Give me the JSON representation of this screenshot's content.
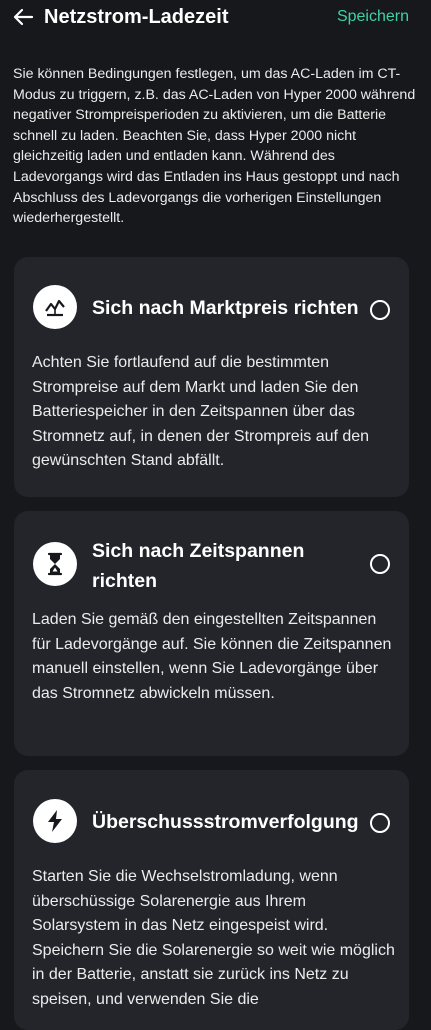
{
  "header": {
    "title": "Netzstrom-Ladezeit",
    "save_label": "Speichern"
  },
  "intro": "Sie können Bedingungen festlegen, um das AC-Laden im CT-Modus zu triggern, z.B. das AC-Laden von Hyper 2000 während negativer Strompreisperioden zu aktivieren, um die Batterie schnell zu laden. Beachten Sie, dass Hyper 2000 nicht gleichzeitig laden und entladen kann. Während des Ladevorgangs wird das Entladen ins Haus gestoppt und nach Abschluss des Ladevorgangs die vorherigen Einstellungen wiederhergestellt.",
  "options": [
    {
      "title": "Sich nach Marktpreis richten",
      "description": "Achten Sie fortlaufend auf die bestimmten Strompreise auf dem Markt und laden Sie den Batteriespeicher in den Zeitspannen über das Stromnetz auf, in denen der Strompreis auf den gewünschten Stand abfällt.",
      "icon": "market-price-icon",
      "selected": false
    },
    {
      "title": "Sich nach Zeitspannen richten",
      "description": "Laden Sie gemäß den eingestellten Zeitspannen für Ladevorgänge auf. Sie können die Zeitspannen manuell einstellen, wenn Sie Ladevorgänge über das Stromnetz abwickeln müssen.",
      "icon": "hourglass-icon",
      "selected": false
    },
    {
      "title": "Überschussstromverfolgung",
      "description": "Starten Sie die Wechselstromladung, wenn überschüssige Solarenergie aus Ihrem Solarsystem in das Netz eingespeist wird. Speichern Sie die Solarenergie so weit wie möglich in der Batterie, anstatt sie zurück ins Netz zu speisen, und verwenden Sie die",
      "icon": "lightning-icon",
      "selected": false
    }
  ],
  "colors": {
    "background": "#17181c",
    "card": "#23252b",
    "accent": "#3fd1a5",
    "text": "#ffffff"
  }
}
